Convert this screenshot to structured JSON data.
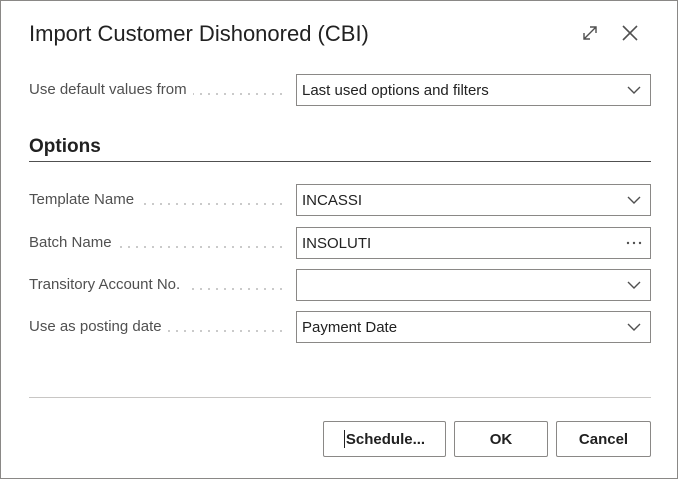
{
  "dialog": {
    "title": "Import Customer Dishonored (CBI)",
    "expand_icon": "expand-icon",
    "close_icon": "close-icon"
  },
  "defaults": {
    "label": "Use default values from",
    "value": "Last used options and filters"
  },
  "options": {
    "section_title": "Options",
    "fields": [
      {
        "label": "Template Name",
        "value": "INCASSI",
        "control": "dropdown"
      },
      {
        "label": "Batch Name",
        "value": "INSOLUTI",
        "control": "lookup"
      },
      {
        "label": "Transitory Account No.",
        "value": "",
        "control": "dropdown"
      },
      {
        "label": "Use as posting date",
        "value": "Payment Date",
        "control": "dropdown"
      }
    ]
  },
  "buttons": {
    "schedule": "Schedule...",
    "ok": "OK",
    "cancel": "Cancel"
  },
  "colors": {
    "border": "#8a8886",
    "text": "#212121",
    "label": "#505050"
  }
}
